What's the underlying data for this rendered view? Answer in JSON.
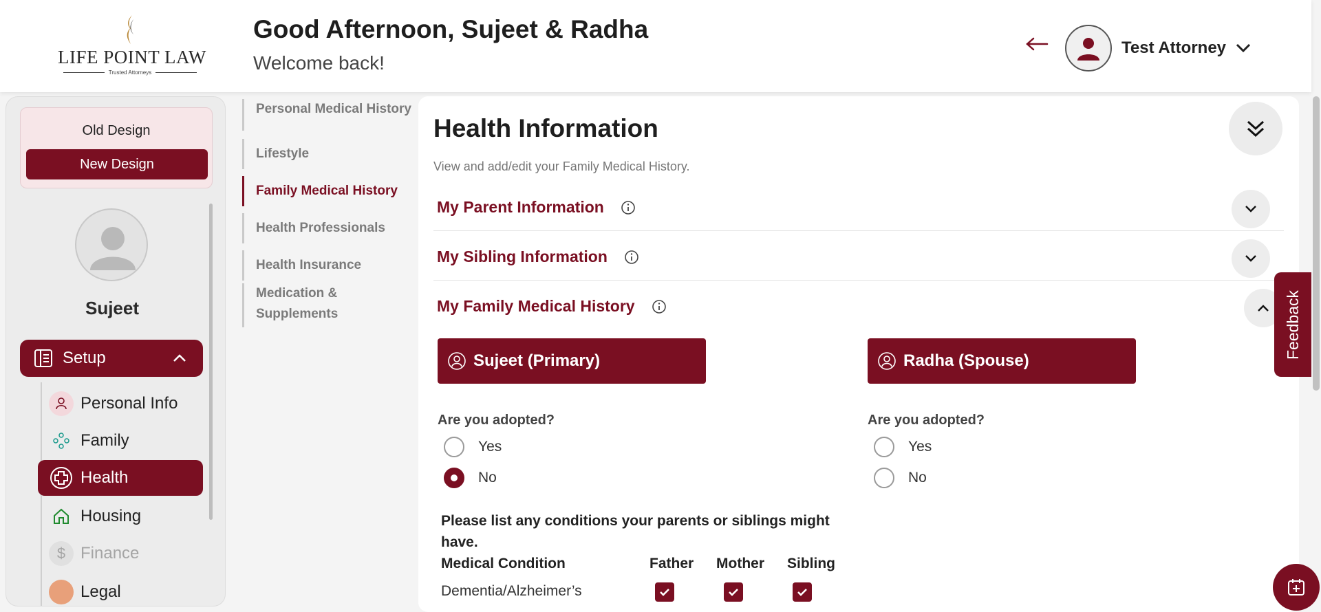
{
  "header": {
    "logo_text": "LIFE POINT LAW",
    "logo_tagline": "Trusted Attorneys",
    "greeting": "Good Afternoon, Sujeet & Radha",
    "welcome": "Welcome back!",
    "user_name": "Test Attorney"
  },
  "sidebar": {
    "old_design": "Old Design",
    "new_design": "New Design",
    "profile_name": "Sujeet",
    "setup_label": "Setup",
    "items": [
      {
        "label": "Personal Info",
        "icon": "person-icon"
      },
      {
        "label": "Family",
        "icon": "family-icon"
      },
      {
        "label": "Health",
        "icon": "health-plus-icon",
        "active": true
      },
      {
        "label": "Housing",
        "icon": "home-icon"
      },
      {
        "label": "Finance",
        "icon": "dollar-icon"
      },
      {
        "label": "Legal",
        "icon": "legal-icon"
      }
    ]
  },
  "subnav": {
    "items": [
      {
        "label": "Personal Medical History"
      },
      {
        "label": "Lifestyle"
      },
      {
        "label": "Family Medical History",
        "active": true
      },
      {
        "label": "Health Professionals"
      },
      {
        "label": "Health Insurance"
      },
      {
        "label": "Medication & Supplements"
      }
    ]
  },
  "main": {
    "title": "Health Information",
    "subtitle": "View and add/edit your Family Medical History.",
    "sections": [
      {
        "title": "My Parent Information",
        "expanded": false
      },
      {
        "title": "My Sibling Information",
        "expanded": false
      },
      {
        "title": "My Family Medical History",
        "expanded": true
      }
    ],
    "persons": [
      {
        "name": "Sujeet (Primary)",
        "question": "Are you adopted?",
        "options": [
          "Yes",
          "No"
        ],
        "selected": "No"
      },
      {
        "name": "Radha (Spouse)",
        "question": "Are you adopted?",
        "options": [
          "Yes",
          "No"
        ],
        "selected": null
      }
    ],
    "conditions_question": "Please list any conditions your parents or siblings might have.",
    "conditions_table": {
      "headers": [
        "Medical Condition",
        "Father",
        "Mother",
        "Sibling"
      ],
      "rows": [
        {
          "condition": "Dementia/Alzheimer’s",
          "father": true,
          "mother": true,
          "sibling": true
        }
      ]
    }
  },
  "feedback_label": "Feedback",
  "colors": {
    "brand": "#7a0f22",
    "background": "#f4f4f4"
  }
}
